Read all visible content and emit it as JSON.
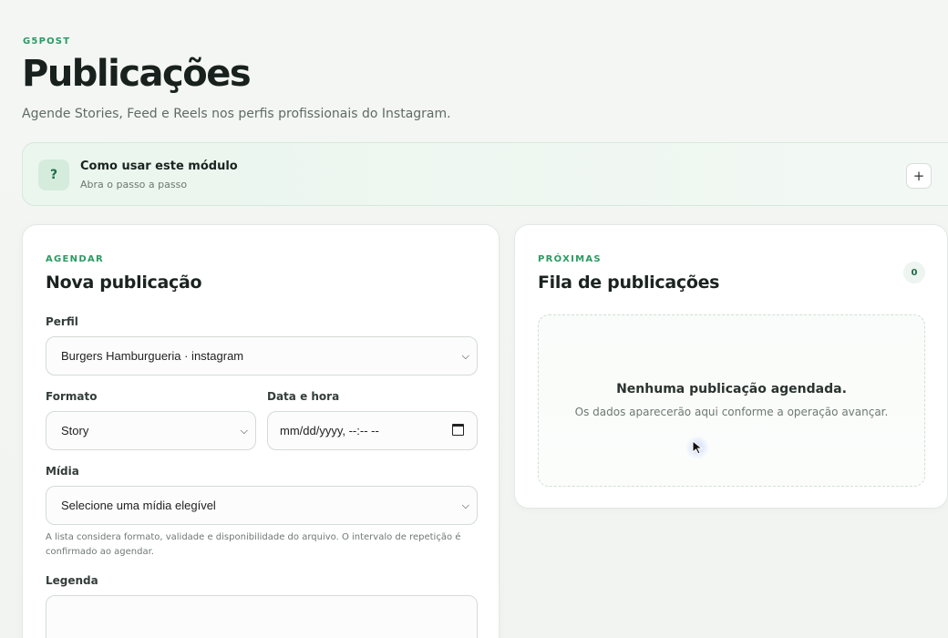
{
  "brand": "G5POST",
  "header": {
    "title": "Publicações",
    "subtitle": "Agende Stories, Feed e Reels nos perfis profissionais do Instagram."
  },
  "help": {
    "icon": "?",
    "title": "Como usar este módulo",
    "subtitle": "Abra o passo a passo",
    "toggle": "+"
  },
  "schedule": {
    "eyebrow": "AGENDAR",
    "title": "Nova publicação",
    "profile": {
      "label": "Perfil",
      "value": "Burgers Hamburgueria · instagram"
    },
    "format": {
      "label": "Formato",
      "value": "Story"
    },
    "datetime": {
      "label": "Data e hora",
      "value": "mm/dd/yyyy, --:-- --"
    },
    "media": {
      "label": "Mídia",
      "value": "Selecione uma mídia elegível"
    },
    "hint": "A lista considera formato, validade e disponibilidade do arquivo. O intervalo de repetição é confirmado ao agendar.",
    "caption": {
      "label": "Legenda",
      "value": ""
    }
  },
  "queue": {
    "eyebrow": "PRÓXIMAS",
    "title": "Fila de publicações",
    "count": "0",
    "empty_title": "Nenhuma publicação agendada.",
    "empty_subtitle": "Os dados aparecerão aqui conforme a operação avançar."
  },
  "colors": {
    "accent": "#2a9a62",
    "background": "#f3f5f3",
    "card": "#ffffff"
  },
  "icons": {
    "help": "question-icon",
    "toggle": "plus-icon",
    "select": "chevron-down-icon",
    "date": "calendar-icon",
    "pointer": "mouse-cursor-icon"
  }
}
